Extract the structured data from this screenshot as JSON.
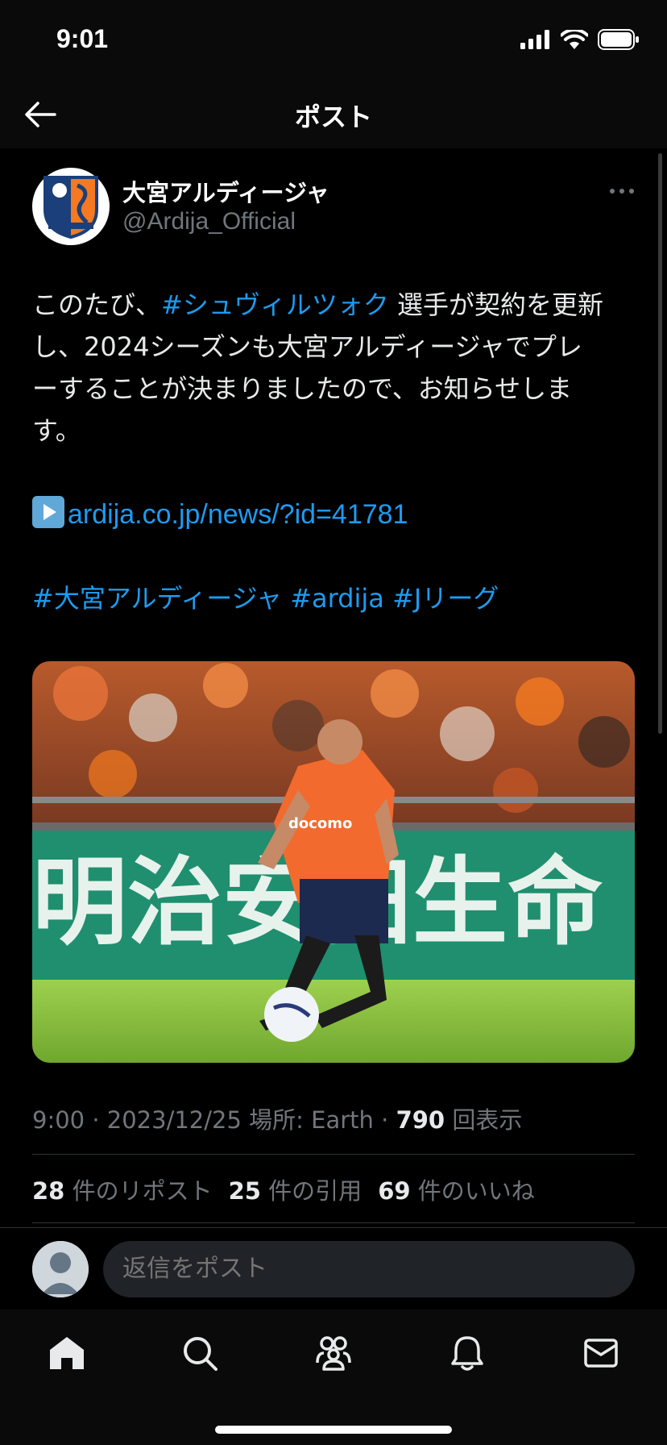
{
  "status_bar": {
    "time": "9:01"
  },
  "nav": {
    "title": "ポスト",
    "back_icon": "arrow-left-icon"
  },
  "author": {
    "display_name": "大宮アルディージャ",
    "handle": "@Ardija_Official"
  },
  "tweet": {
    "line1_pre": "このたび、",
    "line1_tag": "#シュヴィルツォク",
    "line1_post": " 選手が契約を更新",
    "line2": "し、2024シーズンも大宮アルディージャでプレ",
    "line3": "ーすることが決まりましたので、お知らせしま",
    "line4": "す。",
    "link": "ardija.co.jp/news/?id=41781",
    "hashtags": [
      "#大宮アルディージャ",
      "#ardija",
      "#Jリーグ"
    ]
  },
  "media": {
    "banner_text": "明治安田生命"
  },
  "meta": {
    "time": "9:00",
    "date": "2023/12/25",
    "location": "場所: Earth",
    "views": "790",
    "views_label": "回表示"
  },
  "stats": {
    "reposts": "28",
    "reposts_label": "件のリポスト",
    "quotes": "25",
    "quotes_label": "件の引用",
    "likes": "69",
    "likes_label": "件のいいね"
  },
  "reply": {
    "placeholder": "返信をポスト"
  },
  "tabs": [
    "home-icon",
    "search-icon",
    "communities-icon",
    "notifications-icon",
    "messages-icon"
  ],
  "colors": {
    "accent": "#1d9bf0",
    "background": "#000000",
    "secondary_text": "#71767b"
  }
}
